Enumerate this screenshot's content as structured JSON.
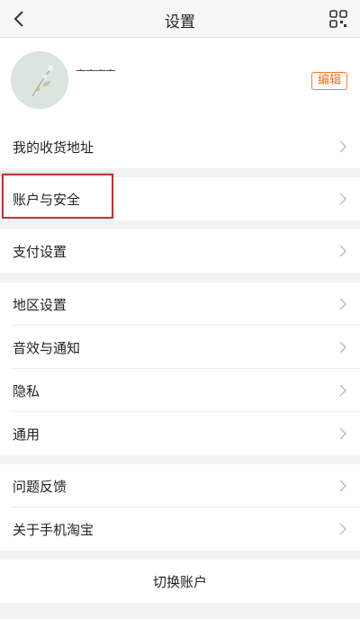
{
  "header": {
    "title": "设置",
    "back_icon": "chevron-left-icon",
    "qr_icon": "qr-code-icon"
  },
  "profile": {
    "username": "ᅩᅩᅩᅩ",
    "edit_label": "编辑",
    "accent": "#ff6a1a"
  },
  "groups": {
    "address": "我的收货地址",
    "account_security": "账户与安全",
    "payment": "支付设置",
    "region": "地区设置",
    "sound_notify": "音效与通知",
    "privacy": "隐私",
    "general": "通用",
    "feedback": "问题反馈",
    "about": "关于手机淘宝"
  },
  "switch_account": "切换账户",
  "highlight_color": "#b23a3a"
}
